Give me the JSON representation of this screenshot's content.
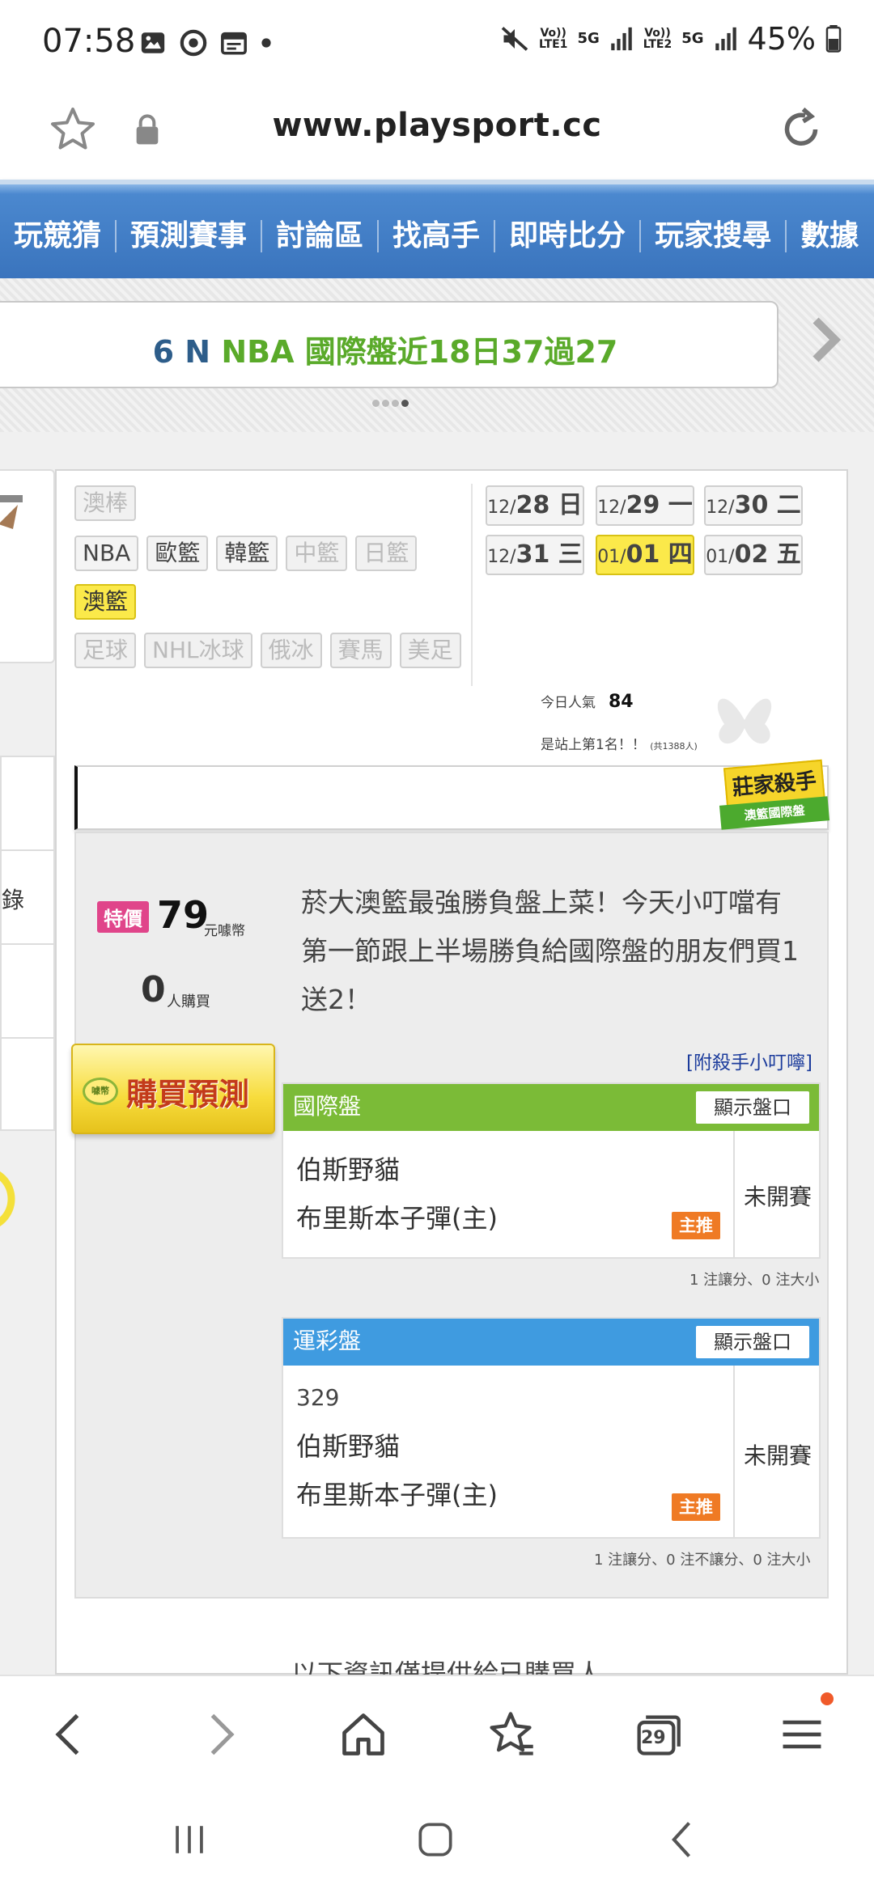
{
  "status_bar": {
    "time": "07:58",
    "network_1": "5G",
    "sim_1": "LTE1",
    "network_2": "5G",
    "sim_2": "LTE2",
    "battery": "45%",
    "volte_1": "Vo))",
    "volte_2": "Vo))"
  },
  "browser": {
    "url": "www.playsport.cc",
    "tabs_count": "29"
  },
  "nav": {
    "items": [
      "玩競猜",
      "預測賽事",
      "討論區",
      "找高手",
      "即時比分",
      "玩家搜尋",
      "數據"
    ]
  },
  "ticker": {
    "prefix": "6 N",
    "text": "NBA 國際盤近18日37過27"
  },
  "sports": {
    "row1": [
      "澳棒"
    ],
    "row2": [
      "NBA",
      "歐籃",
      "韓籃",
      "中籃",
      "日籃"
    ],
    "row3": [
      "澳籃"
    ],
    "row4": [
      "足球",
      "NHL冰球",
      "俄冰",
      "賽馬",
      "美足"
    ]
  },
  "dates": [
    {
      "mo": "12/",
      "day": "28",
      "wd": "日"
    },
    {
      "mo": "12/",
      "day": "29",
      "wd": "一"
    },
    {
      "mo": "12/",
      "day": "30",
      "wd": "二"
    },
    {
      "mo": "12/",
      "day": "31",
      "wd": "三"
    },
    {
      "mo": "01/",
      "day": "01",
      "wd": "四"
    },
    {
      "mo": "01/",
      "day": "02",
      "wd": "五"
    }
  ],
  "popularity": {
    "label": "今日人氣",
    "value": "84",
    "rank_text": "是站上第1名！！",
    "rank_total": "(共1388人)"
  },
  "badge": {
    "title": "莊家殺手",
    "subtitle": "澳籃國際盤"
  },
  "left_menu": {
    "partial_label": "錄"
  },
  "prediction": {
    "special_label": "特價",
    "price": "79",
    "price_unit": "元噱幣",
    "buyers": "0",
    "buyers_unit": "人購買",
    "buy_button": "購買預測",
    "coin_label": "噱幣",
    "description": "菸大澳籃最強勝負盤上菜！今天小叮噹有第一節跟上半場勝負給國際盤的朋友們買1送2！",
    "attach_link": "[附殺手小叮嚀]"
  },
  "markets": [
    {
      "title": "國際盤",
      "show_button": "顯示盤口",
      "game_number": "",
      "team_away": "伯斯野貓",
      "team_home": "布里斯本子彈(主)",
      "pick_label": "主推",
      "status": "未開賽",
      "note": "1 注讓分、0 注大小"
    },
    {
      "title": "運彩盤",
      "show_button": "顯示盤口",
      "game_number": "329",
      "team_away": "伯斯野貓",
      "team_home": "布里斯本子彈(主)",
      "pick_label": "主推",
      "status": "未開賽",
      "note": "1 注讓分、0 注不讓分、0 注大小"
    }
  ],
  "footer_text": "以下資訊僅提供給已購買人",
  "colors": {
    "nav_blue": "#3a74bd",
    "ticker_green": "#5aaa2a",
    "ticker_blue": "#2d5d8a",
    "market_green": "#7bbb37",
    "market_blue": "#3f9be0",
    "pick_orange": "#ef7a24",
    "highlight_yellow": "#fbe94a",
    "special_pink": "#e0458a"
  }
}
